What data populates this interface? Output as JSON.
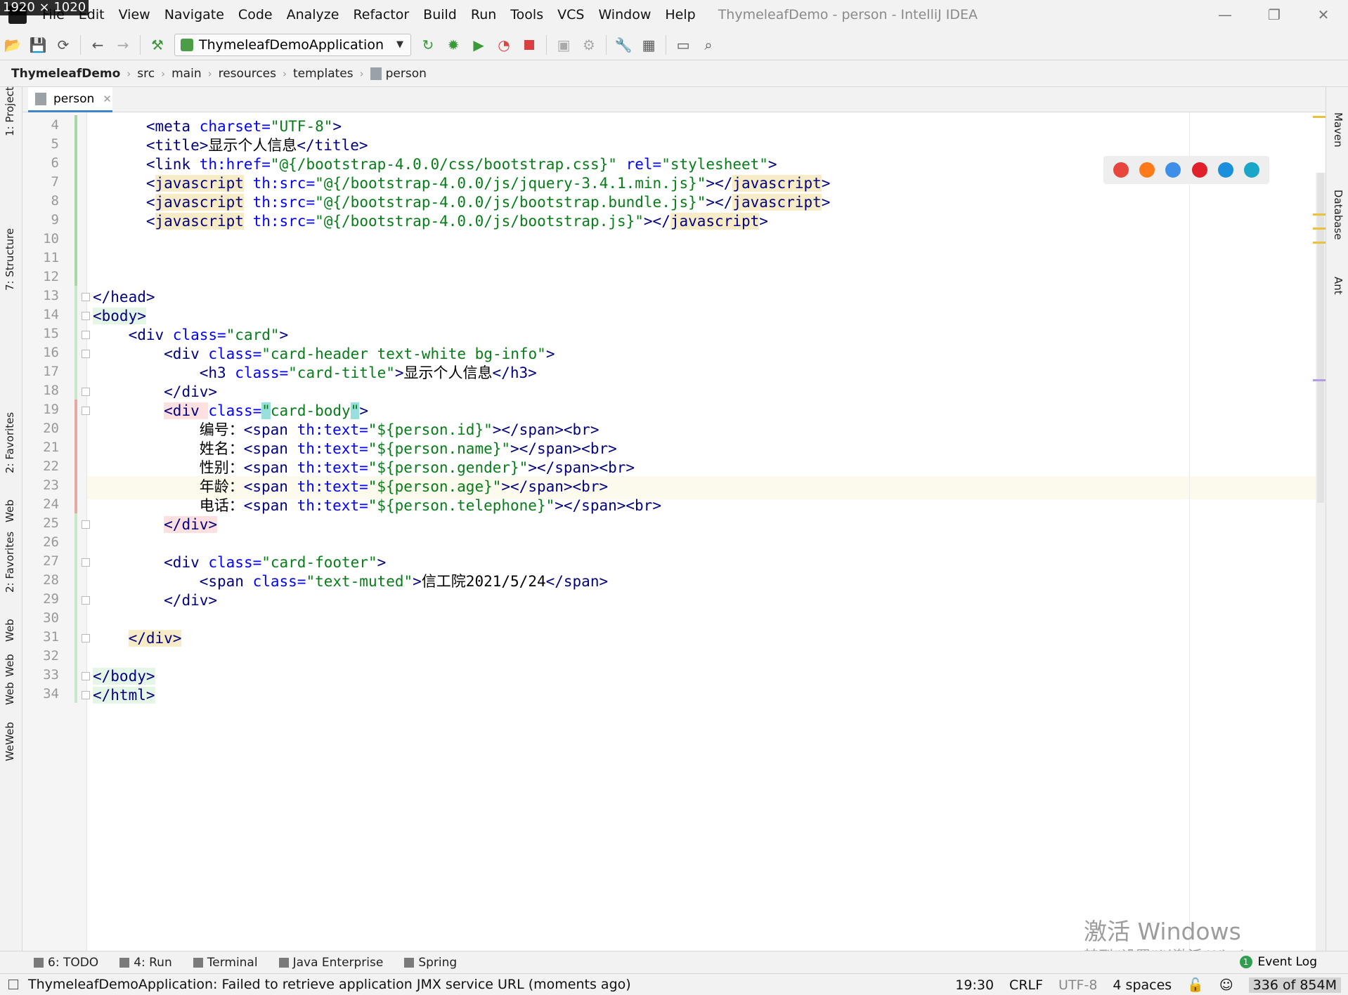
{
  "size_label": "1920 × 1020",
  "menu": {
    "items": [
      "File",
      "Edit",
      "View",
      "Navigate",
      "Code",
      "Analyze",
      "Refactor",
      "Build",
      "Run",
      "Tools",
      "VCS",
      "Window",
      "Help"
    ],
    "window_title": "ThymeleafDemo - person - IntelliJ IDEA"
  },
  "toolbar": {
    "run_config": "ThymeleafDemoApplication",
    "icons": [
      "open-icon",
      "save-icon",
      "sync-icon",
      "back-icon",
      "forward-icon",
      "build-hammer-icon",
      "rerun-icon",
      "debug-icon",
      "coverage-icon",
      "profile-icon",
      "stop-icon",
      "attach-icon",
      "deploy-icon",
      "settings-wrench-icon",
      "project-structure-icon",
      "terminal-icon",
      "search-icon"
    ]
  },
  "breadcrumb": [
    "ThymeleafDemo",
    "src",
    "main",
    "resources",
    "templates",
    "person"
  ],
  "tab": {
    "label": "person"
  },
  "left_tools": [
    "1: Project",
    "7: Structure",
    "2: Favorites",
    "Web",
    "2: Favorites",
    "Web",
    "Web",
    "Web",
    "WeWeb"
  ],
  "right_tools": [
    "Maven",
    "Database",
    "Ant"
  ],
  "editor": {
    "lines": [
      {
        "n": "4",
        "segs": [
          [
            "      ",
            "tx"
          ],
          [
            "<meta ",
            "tg"
          ],
          [
            "charset=",
            "at"
          ],
          [
            "\"UTF-8\"",
            "av"
          ],
          [
            ">",
            "tg"
          ]
        ]
      },
      {
        "n": "5",
        "segs": [
          [
            "      ",
            "tx"
          ],
          [
            "<title>",
            "tg"
          ],
          [
            "显示个人信息",
            "tx"
          ],
          [
            "</title>",
            "tg"
          ]
        ]
      },
      {
        "n": "6",
        "segs": [
          [
            "      ",
            "tx"
          ],
          [
            "<link ",
            "tg"
          ],
          [
            "th:href=",
            "at"
          ],
          [
            "\"@{/bootstrap-4.0.0/css/bootstrap.css}\" ",
            "av"
          ],
          [
            "rel=",
            "at"
          ],
          [
            "\"stylesheet\"",
            "av"
          ],
          [
            ">",
            "tg"
          ]
        ]
      },
      {
        "n": "7",
        "segs": [
          [
            "      ",
            "tx"
          ],
          [
            "<",
            "tg"
          ],
          [
            "javascript",
            "tg hl"
          ],
          [
            " th:src=",
            "at"
          ],
          [
            "\"@{/bootstrap-4.0.0/js/jquery-3.4.1.min.js}\"",
            "av"
          ],
          [
            "></",
            "tg"
          ],
          [
            "javascript",
            "tg hl"
          ],
          [
            ">",
            "tg"
          ]
        ]
      },
      {
        "n": "8",
        "segs": [
          [
            "      ",
            "tx"
          ],
          [
            "<",
            "tg"
          ],
          [
            "javascript",
            "tg hl"
          ],
          [
            " th:src=",
            "at"
          ],
          [
            "\"@{/bootstrap-4.0.0/js/bootstrap.bundle.js}\"",
            "av"
          ],
          [
            "></",
            "tg"
          ],
          [
            "javascript",
            "tg hl"
          ],
          [
            ">",
            "tg"
          ]
        ]
      },
      {
        "n": "9",
        "segs": [
          [
            "      ",
            "tx"
          ],
          [
            "<",
            "tg"
          ],
          [
            "javascript",
            "tg hl"
          ],
          [
            " th:src=",
            "at"
          ],
          [
            "\"@{/bootstrap-4.0.0/js/bootstrap.js}\"",
            "av"
          ],
          [
            "></",
            "tg"
          ],
          [
            "javascript",
            "tg hl"
          ],
          [
            ">",
            "tg"
          ]
        ]
      },
      {
        "n": "10",
        "segs": []
      },
      {
        "n": "11",
        "segs": []
      },
      {
        "n": "12",
        "segs": []
      },
      {
        "n": "13",
        "segs": [
          [
            "</head>",
            "tg"
          ]
        ]
      },
      {
        "n": "14",
        "segs": [
          [
            "<body>",
            "tg hb"
          ]
        ]
      },
      {
        "n": "15",
        "segs": [
          [
            "    ",
            "tx"
          ],
          [
            "<div ",
            "tg"
          ],
          [
            "class=",
            "at"
          ],
          [
            "\"card\"",
            "av"
          ],
          [
            ">",
            "tg"
          ]
        ]
      },
      {
        "n": "16",
        "segs": [
          [
            "        ",
            "tx"
          ],
          [
            "<div ",
            "tg"
          ],
          [
            "class=",
            "at"
          ],
          [
            "\"card-header text-white bg-info\"",
            "av"
          ],
          [
            ">",
            "tg"
          ]
        ]
      },
      {
        "n": "17",
        "segs": [
          [
            "            ",
            "tx"
          ],
          [
            "<h3 ",
            "tg"
          ],
          [
            "class=",
            "at"
          ],
          [
            "\"card-title\"",
            "av"
          ],
          [
            ">",
            "tg"
          ],
          [
            "显示个人信息",
            "tx"
          ],
          [
            "</h3>",
            "tg"
          ]
        ]
      },
      {
        "n": "18",
        "segs": [
          [
            "        ",
            "tx"
          ],
          [
            "</div>",
            "tg"
          ]
        ]
      },
      {
        "n": "19",
        "segs": [
          [
            "        ",
            "tx"
          ],
          [
            "<div ",
            "tg hr"
          ],
          [
            "class=",
            "at"
          ],
          [
            "\"",
            "av hc"
          ],
          [
            "card-body",
            "av"
          ],
          [
            "\"",
            "av hc"
          ],
          [
            ">",
            "tg"
          ]
        ]
      },
      {
        "n": "20",
        "segs": [
          [
            "            ",
            "tx"
          ],
          [
            "编号：",
            "tx"
          ],
          [
            "<span ",
            "tg"
          ],
          [
            "th:text=",
            "at"
          ],
          [
            "\"${person.id}\"",
            "av"
          ],
          [
            "></span><br>",
            "tg"
          ]
        ]
      },
      {
        "n": "21",
        "segs": [
          [
            "            ",
            "tx"
          ],
          [
            "姓名：",
            "tx"
          ],
          [
            "<span ",
            "tg"
          ],
          [
            "th:text=",
            "at"
          ],
          [
            "\"${person.name}\"",
            "av"
          ],
          [
            "></span><br>",
            "tg"
          ]
        ]
      },
      {
        "n": "22",
        "segs": [
          [
            "            ",
            "tx"
          ],
          [
            "性别：",
            "tx"
          ],
          [
            "<span ",
            "tg"
          ],
          [
            "th:text=",
            "at"
          ],
          [
            "\"${person.gender}\"",
            "av"
          ],
          [
            "></span><br>",
            "tg"
          ]
        ]
      },
      {
        "n": "23",
        "segs": [
          [
            "            ",
            "tx"
          ],
          [
            "年龄：",
            "tx"
          ],
          [
            "<span ",
            "tg"
          ],
          [
            "th:text=",
            "at"
          ],
          [
            "\"${person.age}\"",
            "av"
          ],
          [
            "></span><br>",
            "tg"
          ]
        ]
      },
      {
        "n": "24",
        "segs": [
          [
            "            ",
            "tx"
          ],
          [
            "电话：",
            "tx"
          ],
          [
            "<span ",
            "tg"
          ],
          [
            "th:text=",
            "at"
          ],
          [
            "\"${person.telephone}\"",
            "av"
          ],
          [
            "></span><br>",
            "tg"
          ]
        ]
      },
      {
        "n": "25",
        "segs": [
          [
            "        ",
            "tx"
          ],
          [
            "</div>",
            "tg hr"
          ]
        ]
      },
      {
        "n": "26",
        "segs": []
      },
      {
        "n": "27",
        "segs": [
          [
            "        ",
            "tx"
          ],
          [
            "<div ",
            "tg"
          ],
          [
            "class=",
            "at"
          ],
          [
            "\"card-footer\"",
            "av"
          ],
          [
            ">",
            "tg"
          ]
        ]
      },
      {
        "n": "28",
        "segs": [
          [
            "            ",
            "tx"
          ],
          [
            "<span ",
            "tg"
          ],
          [
            "class=",
            "at"
          ],
          [
            "\"text-muted\"",
            "av"
          ],
          [
            ">",
            "tg"
          ],
          [
            "信工院2021/5/24",
            "tx"
          ],
          [
            "</span>",
            "tg"
          ]
        ]
      },
      {
        "n": "29",
        "segs": [
          [
            "        ",
            "tx"
          ],
          [
            "</div>",
            "tg"
          ]
        ]
      },
      {
        "n": "30",
        "segs": []
      },
      {
        "n": "31",
        "segs": [
          [
            "    ",
            "tx"
          ],
          [
            "</div>",
            "tg hl"
          ]
        ]
      },
      {
        "n": "32",
        "segs": []
      },
      {
        "n": "33",
        "segs": [
          [
            "</body>",
            "tg hb"
          ]
        ]
      },
      {
        "n": "34",
        "segs": [
          [
            "</html>",
            "tg hb"
          ]
        ]
      }
    ]
  },
  "browsers": [
    {
      "name": "chrome-icon",
      "color": "#e8453c"
    },
    {
      "name": "firefox-icon",
      "color": "#ff7a1a"
    },
    {
      "name": "safari-icon",
      "color": "#3d8fe8"
    },
    {
      "name": "opera-icon",
      "color": "#e0202a"
    },
    {
      "name": "ie-icon",
      "color": "#1a8fdc"
    },
    {
      "name": "edge-icon",
      "color": "#1aa6c9"
    }
  ],
  "watermark": {
    "line1": "激活 Windows",
    "line2": "转到“设置”以激活 Windows。"
  },
  "bottom_tools": [
    "6: TODO",
    "4: Run",
    "Terminal",
    "Java Enterprise",
    "Spring"
  ],
  "event_log": {
    "label": "Event Log",
    "count": "1"
  },
  "status": {
    "message": "ThymeleafDemoApplication: Failed to retrieve application JMX service URL (moments ago)",
    "position": "19:30",
    "line_sep": "CRLF",
    "encoding": "UTF-8",
    "indent": "4 spaces",
    "memory": "336 of 854M"
  }
}
